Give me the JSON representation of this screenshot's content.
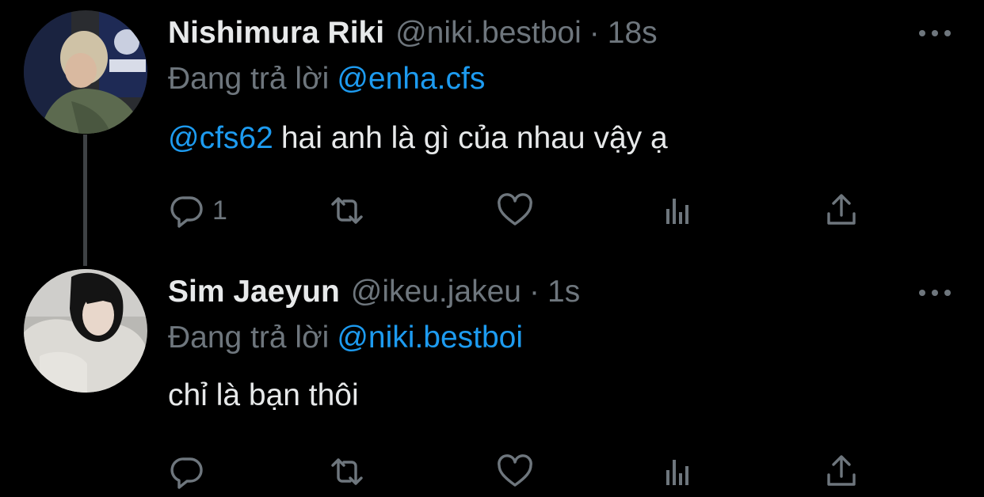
{
  "tweets": [
    {
      "author_name": "Nishimura Riki",
      "handle": "@niki.bestboi",
      "separator": "·",
      "time": "18s",
      "reply_prefix": "Đang trả lời",
      "reply_to": "@enha.cfs",
      "body_mention": "@cfs62",
      "body_text": "hai anh là gì của nhau vậy ạ",
      "reply_count": "1",
      "retweet_count": "",
      "like_count": ""
    },
    {
      "author_name": "Sim Jaeyun",
      "handle": "@ikeu.jakeu",
      "separator": "·",
      "time": "1s",
      "reply_prefix": "Đang trả lời",
      "reply_to": "@niki.bestboi",
      "body_mention": "",
      "body_text": "chỉ là bạn thôi",
      "reply_count": "",
      "retweet_count": "",
      "like_count": ""
    }
  ],
  "icons": {
    "reply": "reply-icon",
    "retweet": "retweet-icon",
    "like": "heart-icon",
    "views": "analytics-icon",
    "share": "share-icon",
    "more": "more-icon"
  },
  "colors": {
    "background": "#000000",
    "text_primary": "#e7e9ea",
    "text_secondary": "#6e767d",
    "accent": "#1d9bf0",
    "thread_line": "#3e4144"
  }
}
